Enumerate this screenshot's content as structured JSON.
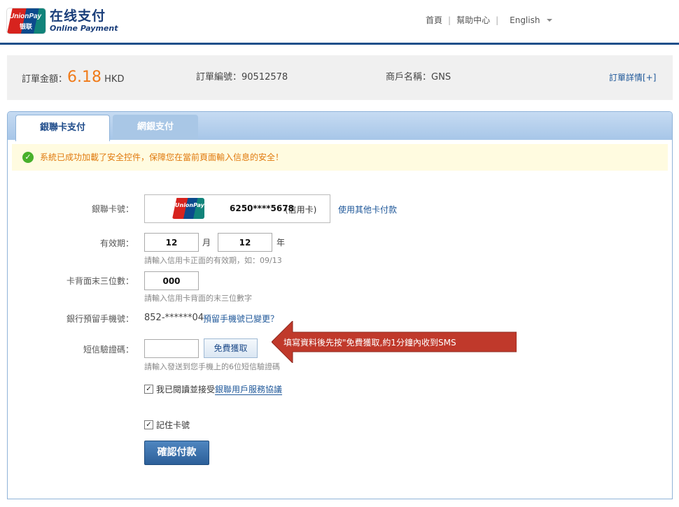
{
  "header": {
    "logo_text": "UnionPay",
    "logo_cn": "银联",
    "brand_cn": "在线支付",
    "brand_en": "Online Payment",
    "nav": [
      {
        "label": "首頁"
      },
      {
        "label": "幫助中心"
      },
      {
        "label": "English"
      }
    ]
  },
  "order": {
    "amount_label": "訂單金額：",
    "amount": "6.18",
    "currency": "HKD",
    "order_no_label": "訂單編號：",
    "order_no": "90512578",
    "merchant_label": "商戶名稱：",
    "merchant": "GNS",
    "detail_link": "訂單詳情[+]"
  },
  "tabs": [
    {
      "label": "銀聯卡支付",
      "active": true
    },
    {
      "label": "網銀支付",
      "active": false
    }
  ],
  "notice": "系統已成功加載了安全控件，保障您在當前頁面輸入信息的安全！",
  "form": {
    "card_label": "銀聯卡號：",
    "card_number": "6250****5678",
    "card_type": "(信用卡)",
    "other_card_link": "使用其他卡付款",
    "expiry_label": "有效期：",
    "expiry_month": "12",
    "month_unit": "月",
    "expiry_year": "12",
    "year_unit": "年",
    "expiry_hint": "請輸入信用卡正面的有效期，如：09/13",
    "cvv_label": "卡背面末三位數：",
    "cvv": "000",
    "cvv_hint": "請輸入信用卡背面的末三位數字",
    "phone_label": "銀行預留手機號：",
    "phone": "852-******04",
    "phone_changed_link": "預留手機號已變更？",
    "sms_label": "短信驗證碼：",
    "sms_value": "",
    "sms_button": "免費獲取",
    "sms_hint": "請輸入發送到您手機上的6位短信驗證碼",
    "agree_text": "我已閱讀並接受",
    "agree_link": "銀聯用戶服務協議",
    "agree_checked": true,
    "remember_text": "記住卡號",
    "remember_checked": true,
    "confirm_button": "確認付款"
  },
  "annotation": {
    "text": "填寫資料後先按\"免費獲取,約1分鐘內收到SMS",
    "color": "#c0392b"
  },
  "colors": {
    "accent": "#1e4b8a",
    "amount": "#f07b1a",
    "notice_text": "#e07a0e"
  }
}
